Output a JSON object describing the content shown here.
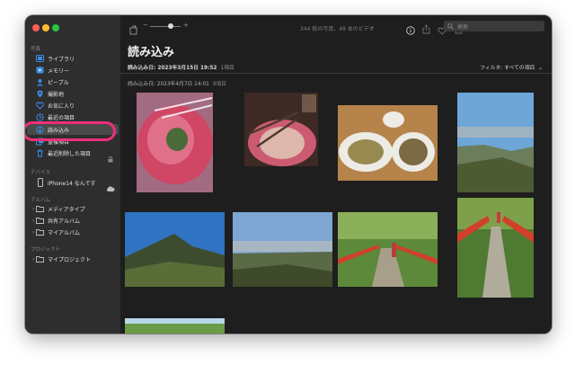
{
  "sidebar": {
    "section_photos": "写真",
    "items": [
      {
        "label": "ライブラリ",
        "icon": "library-icon"
      },
      {
        "label": "メモリー",
        "icon": "memories-icon"
      },
      {
        "label": "ピープル",
        "icon": "people-icon"
      },
      {
        "label": "撮影地",
        "icon": "places-icon"
      },
      {
        "label": "お気に入り",
        "icon": "heart-icon"
      },
      {
        "label": "最近の項目",
        "icon": "recents-icon"
      },
      {
        "label": "読み込み",
        "icon": "import-icon"
      },
      {
        "label": "重複項目",
        "icon": "duplicates-icon"
      },
      {
        "label": "最近削除した項目",
        "icon": "trash-icon"
      }
    ],
    "section_devices": "デバイス",
    "device": {
      "label": "iPhone14 なんです"
    },
    "section_albums": "アルバム",
    "albums": [
      {
        "label": "メディアタイプ"
      },
      {
        "label": "共有アルバム"
      },
      {
        "label": "マイアルバム"
      }
    ],
    "section_projects": "プロジェクト",
    "projects": [
      {
        "label": "マイプロジェクト"
      }
    ]
  },
  "toolbar": {
    "count": "344 枚の写真、49 本のビデオ",
    "search_placeholder": "検索"
  },
  "main": {
    "title": "読み込み",
    "import_date_1": "読み込み日: 2023年3月15日 19:52",
    "import_count_1": "1項目",
    "filter": "フィルタ: すべての項目",
    "import_date_2": "読み込み日: 2023年4月7日 14:01",
    "import_count_2": "9項目"
  },
  "colors": {
    "accent_highlight": "#ee2f7c",
    "sidebar_bg": "#2e2e2e",
    "main_bg": "#1e1e1e",
    "icon_blue": "#3a8ee6"
  }
}
